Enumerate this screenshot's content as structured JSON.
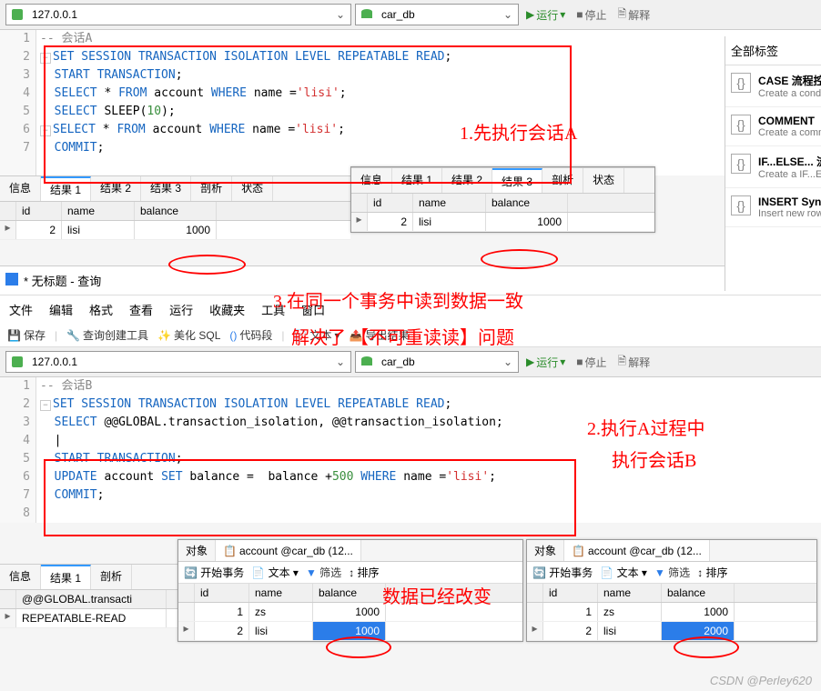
{
  "top": {
    "host": "127.0.0.1",
    "db": "car_db",
    "run": "运行",
    "stop": "停止",
    "explain": "解释"
  },
  "sessionA": {
    "comment": "-- 会话A",
    "lines": {
      "l2a": "SET SESSION TRANSACTION ISOLATION LEVEL REPEATABLE READ",
      "l3": "START TRANSACTION",
      "l4a": "SELECT",
      "l4b": "FROM",
      "l4c": " account ",
      "l4d": "WHERE",
      "l4e": " name =",
      "l4f": "'lisi'",
      "l5a": "SELECT",
      "l5b": " SLEEP(",
      "l5c": "10",
      "l5d": ");",
      "l7": "COMMIT"
    }
  },
  "annot": {
    "a1": "1.先执行会话A",
    "a2a": "2.执行A过程中",
    "a2b": "执行会话B",
    "a3a": "3.在同一个事务中读到数据一致",
    "a3b": "解决了 【不可重读读】问题",
    "a4": "数据已经改变"
  },
  "resultTabs": {
    "info": "信息",
    "r1": "结果 1",
    "r2": "结果 2",
    "r3": "结果 3",
    "prof": "剖析",
    "status": "状态"
  },
  "grid": {
    "id": "id",
    "name": "name",
    "balance": "balance",
    "row1_id": "2",
    "row1_name": "lisi",
    "row1_bal": "1000"
  },
  "sidebar": {
    "head": "全部标签",
    "items": [
      {
        "title": "CASE 流程控制",
        "sub": "Create a conditi"
      },
      {
        "title": "COMMENT",
        "sub": "Create a comme"
      },
      {
        "title": "IF...ELSE... 流",
        "sub": "Create a IF...EL"
      },
      {
        "title": "INSERT Syn",
        "sub": "Insert new rows"
      }
    ]
  },
  "win2": {
    "title": "* 无标题 - 查询",
    "menu": [
      "文件",
      "编辑",
      "格式",
      "查看",
      "运行",
      "收藏夹",
      "工具",
      "窗口"
    ],
    "toolbar": {
      "save": "保存",
      "builder": "查询创建工具",
      "beautify": "美化 SQL",
      "snippet": "代码段",
      "text": "文本",
      "export": "导出结果"
    }
  },
  "sessionB": {
    "comment": "-- 会话B",
    "l1": "SET SESSION TRANSACTION ISOLATION LEVEL REPEATABLE READ",
    "l2a": "SELECT",
    "l2b": " @@GLOBAL.transaction_isolation, @@transaction_isolation;",
    "l4": "START TRANSACTION",
    "l5a": "UPDATE",
    "l5b": " account ",
    "l5c": "SET",
    "l5d": " balance =  balance +",
    "l5e": "500",
    "l5f": "WHERE",
    "l5g": " name =",
    "l5h": "'lisi'",
    "l6": "COMMIT"
  },
  "bottomGrid": {
    "col1": "@@GLOBAL.transacti",
    "val1": "REPEATABLE-READ"
  },
  "subpane": {
    "obj": "对象",
    "tabname": "account @car_db (12...",
    "begin": "开始事务",
    "text": "文本",
    "filter": "筛选",
    "sort": "排序",
    "id": "id",
    "name": "name",
    "balance": "balance",
    "r1_id": "1",
    "r1_name": "zs",
    "r1_bal": "1000",
    "r2_id": "2",
    "r2_name": "lisi",
    "leftbal": "1000",
    "rightbal": "2000"
  },
  "watermark": "CSDN @Perley620"
}
